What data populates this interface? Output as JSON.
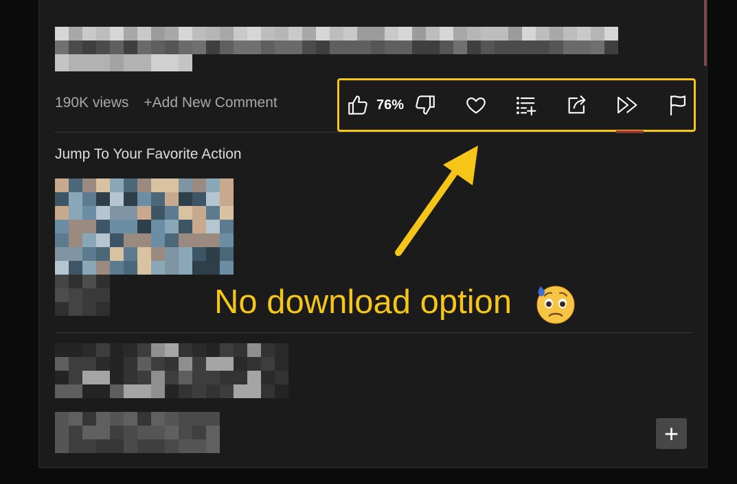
{
  "video": {
    "views": "190K views",
    "add_comment": "+Add New Comment"
  },
  "actions": {
    "like_percent": "76%",
    "icons": [
      "thumbs-up-icon",
      "thumbs-down-icon",
      "heart-icon",
      "add-to-playlist-icon",
      "share-icon",
      "next-icon",
      "flag-icon"
    ]
  },
  "section": {
    "title": "Jump To Your Favorite Action"
  },
  "annotation": {
    "text": "No download option",
    "emoji": "anxious-face-icon",
    "color": "#f5c518"
  },
  "fab": {
    "label": "+"
  },
  "colors": {
    "background": "#1b1b1b",
    "highlight": "#f5c518",
    "text_muted": "#a9a9a9"
  }
}
